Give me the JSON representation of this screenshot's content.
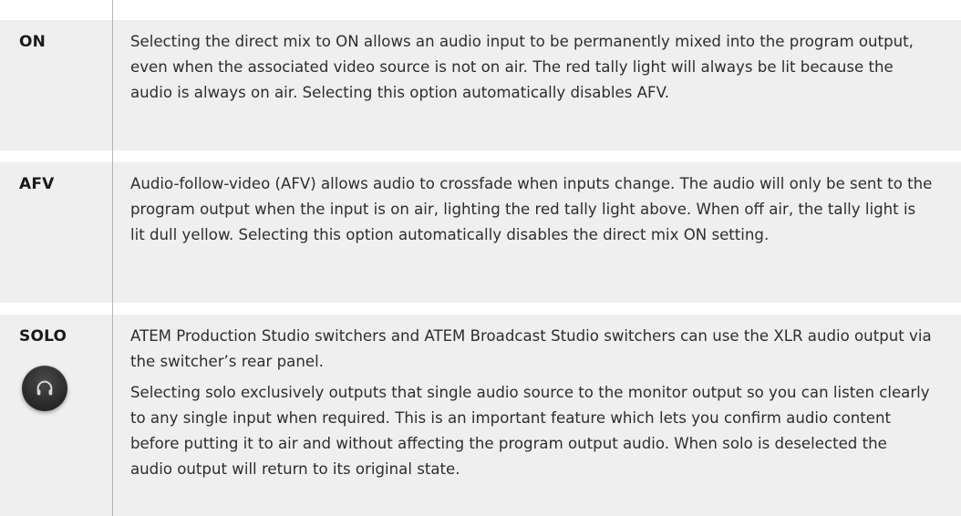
{
  "rows": [
    {
      "term": "ON",
      "paragraphs": [
        "Selecting the direct mix to ON allows an audio input to be permanently mixed into the program output, even when the associated video source is not on air. The red tally light will always be lit because the audio is always on air. Selecting this option automatically disables AFV."
      ]
    },
    {
      "term": "AFV",
      "paragraphs": [
        "Audio-follow-video (AFV) allows audio to crossfade when inputs change. The audio will only be sent to the program output when the input is on air, lighting the red tally light above. When off air, the tally light is lit dull yellow. Selecting this option automatically disables the direct mix ON setting."
      ]
    },
    {
      "term": "SOLO",
      "icon": "headphones-icon",
      "paragraphs": [
        "ATEM Production Studio switchers and ATEM Broadcast Studio switchers can use the XLR audio output via the switcher’s rear panel.",
        "Selecting solo exclusively outputs that single audio source to the monitor output so you can listen clearly to any single input when required. This is an important feature which lets you confirm audio content before putting it to air and without affecting the program output audio. When solo is deselected the audio output will return to its original state."
      ]
    }
  ],
  "colors": {
    "row_background": "#efefef",
    "divider": "#b5b5b5",
    "text": "#2e2e2e",
    "button": "#2c2c2c"
  }
}
